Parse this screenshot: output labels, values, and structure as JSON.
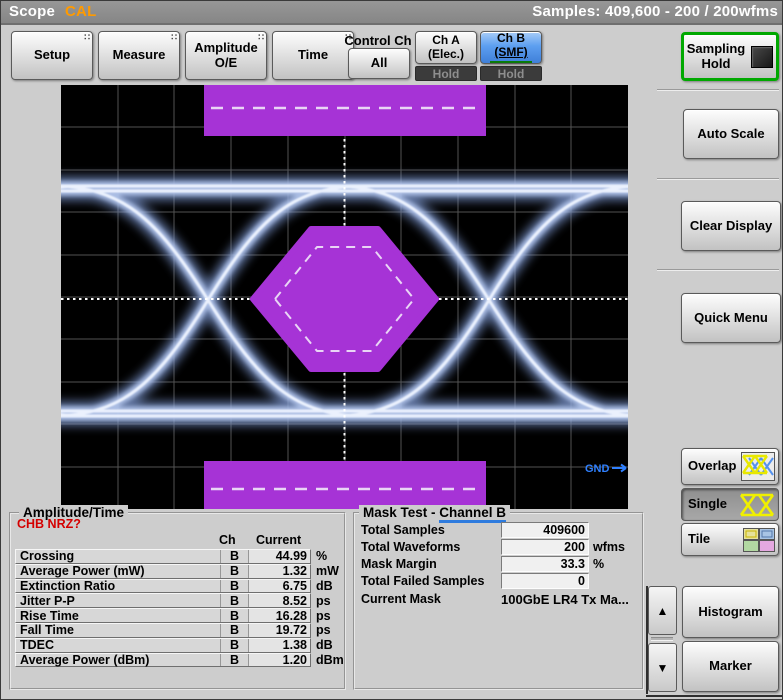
{
  "title_bar": {
    "app_name": "Scope",
    "cal_indicator": "CAL",
    "samples_readout": "Samples: 409,600 - 200 / 200wfms"
  },
  "toolbar": {
    "setup": "Setup",
    "measure": "Measure",
    "amplitude_line1": "Amplitude",
    "amplitude_line2": "O/E",
    "time": "Time",
    "control_ch_label": "Control Ch",
    "control_ch_value": "All",
    "ch_a_line1": "Ch A",
    "ch_a_line2": "(Elec.)",
    "ch_b_line1": "Ch B",
    "ch_b_line2": "(SMF)",
    "ch_a_hold": "Hold",
    "ch_b_hold": "Hold",
    "drag_dots": "∷"
  },
  "right_panel": {
    "sampling_hold_line1": "Sampling",
    "sampling_hold_line2": "Hold",
    "auto_scale": "Auto Scale",
    "clear_display": "Clear Display",
    "quick_menu": "Quick Menu",
    "overlap": "Overlap",
    "single": "Single",
    "tile": "Tile",
    "histogram": "Histogram",
    "marker": "Marker",
    "scroll_up": "▲",
    "scroll_down": "▼"
  },
  "display": {
    "gnd_label": "GND"
  },
  "measurements": {
    "title": "Amplitude/Time",
    "warning": "CHB NRZ?",
    "col_ch": "Ch",
    "col_current": "Current",
    "rows": [
      {
        "label": "Crossing",
        "ch": "B",
        "value": "44.99",
        "unit": "%"
      },
      {
        "label": "Average Power (mW)",
        "ch": "B",
        "value": "1.32",
        "unit": "mW"
      },
      {
        "label": "Extinction Ratio",
        "ch": "B",
        "value": "6.75",
        "unit": "dB"
      },
      {
        "label": "Jitter P-P",
        "ch": "B",
        "value": "8.52",
        "unit": "ps"
      },
      {
        "label": "Rise Time",
        "ch": "B",
        "value": "16.28",
        "unit": "ps"
      },
      {
        "label": "Fall Time",
        "ch": "B",
        "value": "19.72",
        "unit": "ps"
      },
      {
        "label": "TDEC",
        "ch": "B",
        "value": "1.38",
        "unit": "dB"
      },
      {
        "label": "Average Power (dBm)",
        "ch": "B",
        "value": "1.20",
        "unit": "dBm"
      }
    ]
  },
  "mask_test": {
    "title_prefix": "Mask Test - ",
    "title_channel": "Channel B",
    "rows": [
      {
        "label": "Total Samples",
        "value": "409600",
        "unit": ""
      },
      {
        "label": "Total Waveforms",
        "value": "200",
        "unit": "wfms"
      },
      {
        "label": "Mask Margin",
        "value": "33.3",
        "unit": "%"
      },
      {
        "label": "Total Failed Samples",
        "value": "0",
        "unit": ""
      }
    ],
    "current_mask_label": "Current Mask",
    "current_mask_value": "100GbE LR4 Tx Ma..."
  },
  "colors": {
    "mask_purple": "#a633d6",
    "ch_b_blue": "#5d9ff0",
    "cal_orange": "#ff9a00",
    "sampling_hold_green": "#00a800",
    "gnd_blue": "#2f80ff",
    "warning_red": "#d40000",
    "trace_blue": "#bccdf0",
    "channel_b_underline_blue": "#2e7bde"
  }
}
